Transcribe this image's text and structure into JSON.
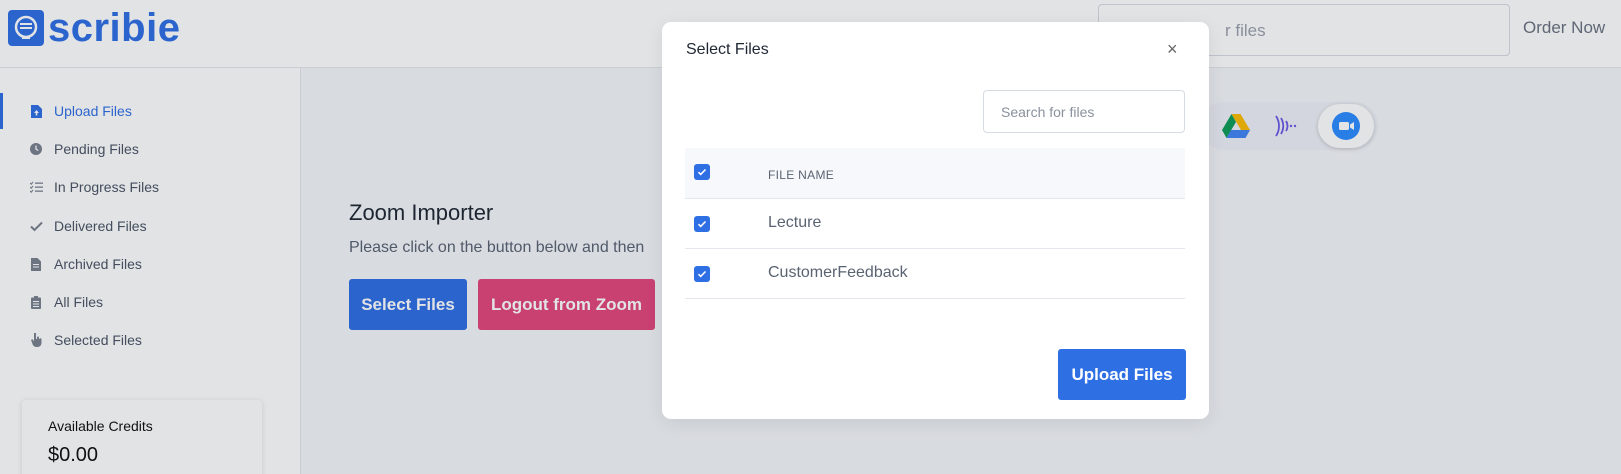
{
  "header": {
    "logo_text": "scribie",
    "search_placeholder_visible": "r files",
    "order_now": "Order Now"
  },
  "sidebar": {
    "items": [
      {
        "label": "Upload Files",
        "icon": "upload-file-icon",
        "active": true
      },
      {
        "label": "Pending Files",
        "icon": "clock-icon",
        "active": false
      },
      {
        "label": "In Progress Files",
        "icon": "checklist-icon",
        "active": false
      },
      {
        "label": "Delivered Files",
        "icon": "check-icon",
        "active": false
      },
      {
        "label": "Archived Files",
        "icon": "archive-file-icon",
        "active": false
      },
      {
        "label": "All Files",
        "icon": "clipboard-icon",
        "active": false
      },
      {
        "label": "Selected Files",
        "icon": "pointer-hand-icon",
        "active": false
      }
    ],
    "credits": {
      "title": "Available Credits",
      "value": "$0.00"
    }
  },
  "main": {
    "title": "Zoom Importer",
    "description": "Please click on the button below and then",
    "select_button": "Select Files",
    "logout_button": "Logout from Zoom",
    "integrations": [
      "google-drive-icon",
      "soundwave-icon",
      "zoom-icon"
    ]
  },
  "modal": {
    "title": "Select Files",
    "close_label": "×",
    "search_placeholder": "Search for files",
    "column_header": "FILE NAME",
    "header_checked": true,
    "rows": [
      {
        "name": "Lecture",
        "checked": true
      },
      {
        "name": "CustomerFeedback",
        "checked": true
      }
    ],
    "upload_button": "Upload Files"
  },
  "colors": {
    "primary": "#2f6fe4",
    "danger": "#e2477a",
    "zoom": "#2d8cff"
  }
}
